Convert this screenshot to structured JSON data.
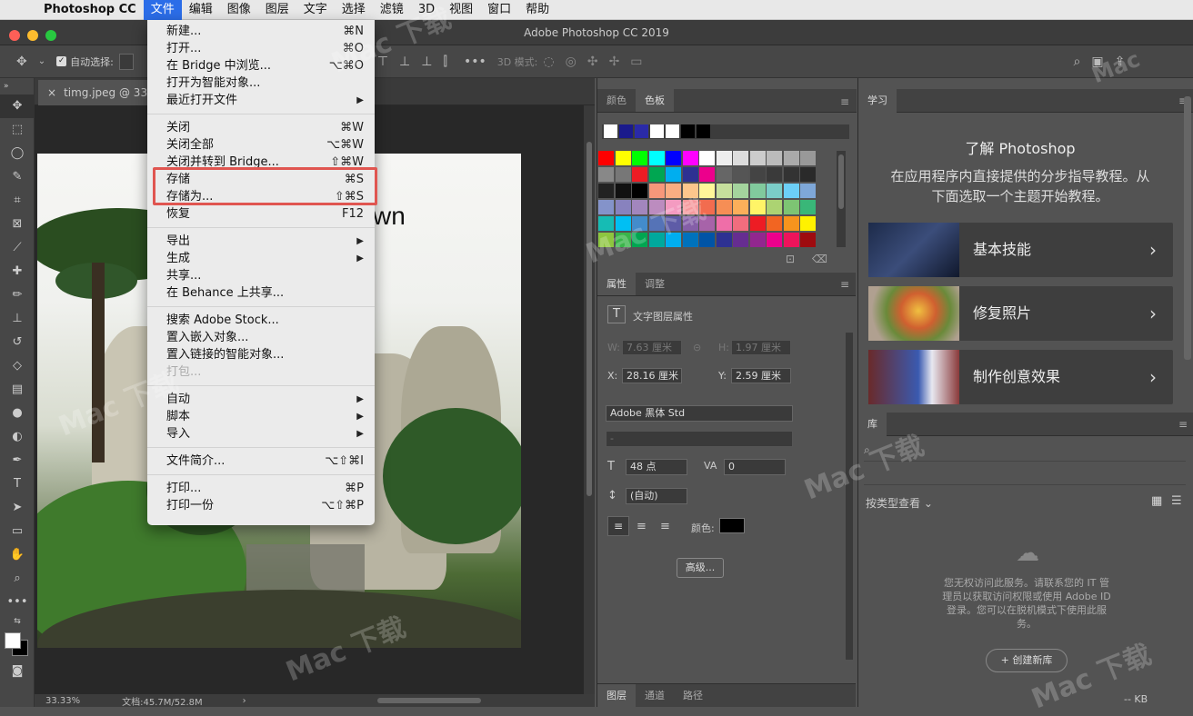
{
  "menubar": {
    "app": "Photoshop CC",
    "items": [
      "文件",
      "编辑",
      "图像",
      "图层",
      "文字",
      "选择",
      "滤镜",
      "3D",
      "视图",
      "窗口",
      "帮助"
    ]
  },
  "window": {
    "title": "Adobe Photoshop CC 2019"
  },
  "options": {
    "auto_select": "自动选择:",
    "mode3d": "3D 模式:"
  },
  "document": {
    "tab": "timg.jpeg @ 33.3",
    "overlay_text": "wn",
    "zoom": "33.33%",
    "doc_size": "文档:45.7M/52.8M"
  },
  "file_menu": {
    "groups": [
      [
        {
          "label": "新建...",
          "shortcut": "⌘N"
        },
        {
          "label": "打开...",
          "shortcut": "⌘O"
        },
        {
          "label": "在 Bridge 中浏览...",
          "shortcut": "⌥⌘O"
        },
        {
          "label": "打开为智能对象...",
          "shortcut": ""
        },
        {
          "label": "最近打开文件",
          "shortcut": "▶"
        }
      ],
      [
        {
          "label": "关闭",
          "shortcut": "⌘W"
        },
        {
          "label": "关闭全部",
          "shortcut": "⌥⌘W"
        },
        {
          "label": "关闭并转到 Bridge...",
          "shortcut": "⇧⌘W"
        },
        {
          "label": "存储",
          "shortcut": "⌘S"
        },
        {
          "label": "存储为...",
          "shortcut": "⇧⌘S"
        },
        {
          "label": "恢复",
          "shortcut": "F12"
        }
      ],
      [
        {
          "label": "导出",
          "shortcut": "▶"
        },
        {
          "label": "生成",
          "shortcut": "▶"
        },
        {
          "label": "共享...",
          "shortcut": ""
        },
        {
          "label": "在 Behance 上共享...",
          "shortcut": ""
        }
      ],
      [
        {
          "label": "搜索 Adobe Stock...",
          "shortcut": ""
        },
        {
          "label": "置入嵌入对象...",
          "shortcut": ""
        },
        {
          "label": "置入链接的智能对象...",
          "shortcut": ""
        },
        {
          "label": "打包...",
          "shortcut": "",
          "disabled": true
        }
      ],
      [
        {
          "label": "自动",
          "shortcut": "▶"
        },
        {
          "label": "脚本",
          "shortcut": "▶"
        },
        {
          "label": "导入",
          "shortcut": "▶"
        }
      ],
      [
        {
          "label": "文件简介...",
          "shortcut": "⌥⇧⌘I"
        }
      ],
      [
        {
          "label": "打印...",
          "shortcut": "⌘P"
        },
        {
          "label": "打印一份",
          "shortcut": "⌥⇧⌘P"
        }
      ]
    ]
  },
  "swatches_panel": {
    "tabs": [
      "颜色",
      "色板"
    ]
  },
  "properties_panel": {
    "tabs": [
      "属性",
      "调整"
    ],
    "header": "文字图层属性",
    "w_label": "W:",
    "w_value": "7.63 厘米",
    "h_label": "H:",
    "h_value": "1.97 厘米",
    "x_label": "X:",
    "x_value": "28.16 厘米",
    "y_label": "Y:",
    "y_value": "2.59 厘米",
    "font": "Adobe 黑体 Std",
    "style": "-",
    "size": "48 点",
    "tracking": "0",
    "leading": "(自动)",
    "color_label": "颜色:",
    "advanced": "高级..."
  },
  "bottom_tabs": [
    "图层",
    "通道",
    "路径"
  ],
  "learn_panel": {
    "tab": "学习",
    "title": "了解 Photoshop",
    "subtitle_1": "在应用程序内直接提供的分步指导教程。从",
    "subtitle_2": "下面选取一个主题开始教程。",
    "cards": [
      "基本技能",
      "修复照片",
      "制作创意效果"
    ]
  },
  "library_panel": {
    "tab": "库",
    "view_by": "按类型查看",
    "message_1": "您无权访问此服务。请联系您的 IT 管",
    "message_2": "理员以获取访问权限或使用 Adobe ID",
    "message_3": "登录。您可以在脱机模式下使用此服",
    "message_4": "务。",
    "create_button": "+ 创建新库",
    "footer": "-- KB"
  },
  "colors": {
    "menu_highlight": "#2b6de8",
    "red_box": "#e05550"
  }
}
